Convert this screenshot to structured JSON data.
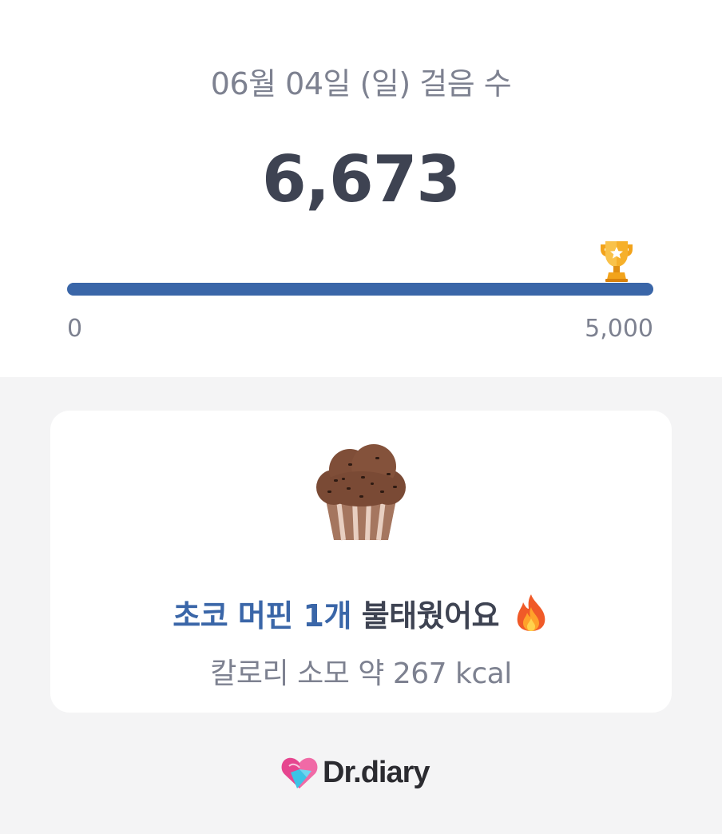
{
  "header": {
    "date_title": "06월 04일 (일) 걸음 수",
    "step_count": "6,673"
  },
  "progress": {
    "min_label": "0",
    "max_label": "5,000",
    "fraction_filled": 1.0,
    "goal_icon": "trophy-icon"
  },
  "card": {
    "food_icon": "muffin-icon",
    "food_text": "초코 머핀 1개",
    "burn_text": "불태웠어요",
    "burn_icon": "fire-icon",
    "calorie_text": "칼로리 소모 약 267 kcal"
  },
  "footer": {
    "logo_icon": "heart-logo-icon",
    "brand_name": "Dr.diary"
  },
  "colors": {
    "accent": "#3a66a8",
    "text_dark": "#3e4352",
    "text_muted": "#7d8190",
    "background": "#f4f4f5"
  }
}
